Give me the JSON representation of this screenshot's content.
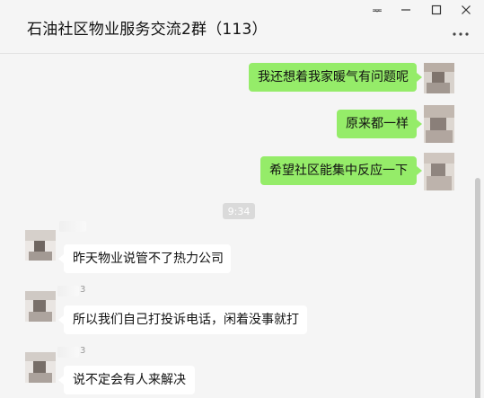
{
  "window": {
    "title": "石油社区物业服务交流2群（113）",
    "pin_glyph": "ᆓ"
  },
  "messages": [
    {
      "direction": "out",
      "text": "我还想着我家暖气有问题呢"
    },
    {
      "direction": "out",
      "text": "原来都一样"
    },
    {
      "direction": "out",
      "text": "希望社区能集中反应一下"
    },
    {
      "type": "time",
      "text": "9:34"
    },
    {
      "direction": "in",
      "sender_digit": "",
      "text": "昨天物业说管不了热力公司"
    },
    {
      "direction": "in",
      "sender_digit": "3",
      "text": "所以我们自己打投诉电话，闲着没事就打"
    },
    {
      "direction": "in",
      "sender_digit": "3",
      "text": "说不定会有人来解决"
    }
  ],
  "colors": {
    "outgoing_bubble": "#95ec69",
    "incoming_bubble": "#ffffff",
    "background": "#f5f5f5"
  }
}
